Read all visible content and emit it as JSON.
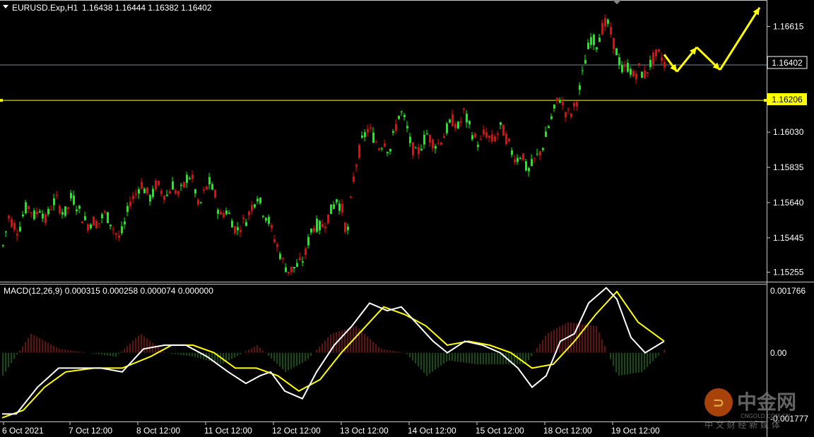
{
  "header": {
    "symbol_label": "EURUSD.Exp,H1",
    "ohlc": "1.16438 1.16444 1.16382 1.16402",
    "menu_icon": "triangle-down-icon"
  },
  "macd": {
    "label": "MACD(12,26,9) 0.000315 0.000258 0.000074 0.000000",
    "scale_top": "0.001766",
    "scale_zero": "0.00",
    "scale_bottom": "-0.001777"
  },
  "price_levels": {
    "current": "1.16402",
    "horizontal": "1.16206"
  },
  "watermark": {
    "brand": "中金网",
    "url": "CNGOLD.COM.CN",
    "tagline": "中 文 财 经 新 媒 体"
  },
  "colors": {
    "background": "#000000",
    "bull": "#00ff00",
    "bear": "#ff0000",
    "macd_line": "#ffffff",
    "signal_line": "#ffff00",
    "hist_pos": "#8b1a1a",
    "hist_neg": "#1f6b1f",
    "hline": "#ffff00",
    "bid_line": "#778899",
    "grid": "#c8c8c8"
  },
  "chart_data": [
    {
      "type": "candlestick",
      "series_name": "EURUSD.Exp,H1",
      "y_ticks": [
        "1.16615",
        "1.16030",
        "1.15835",
        "1.15640",
        "1.15445",
        "1.15255"
      ],
      "ylim": [
        1.1521,
        1.1675
      ],
      "x_ticks": [
        "6 Oct 2021",
        "7 Oct 12:00",
        "8 Oct 12:00",
        "11 Oct 12:00",
        "12 Oct 12:00",
        "13 Oct 12:00",
        "14 Oct 12:00",
        "15 Oct 12:00",
        "18 Oct 12:00",
        "19 Oct 12:00"
      ],
      "close_path": [
        [
          0,
          1.154
        ],
        [
          8,
          1.1556
        ],
        [
          15,
          1.1552
        ],
        [
          22,
          1.1548
        ],
        [
          30,
          1.156
        ],
        [
          37,
          1.1562
        ],
        [
          45,
          1.1556
        ],
        [
          53,
          1.1562
        ],
        [
          60,
          1.1554
        ],
        [
          68,
          1.1562
        ],
        [
          75,
          1.1566
        ],
        [
          82,
          1.156
        ],
        [
          90,
          1.1558
        ],
        [
          97,
          1.1568
        ],
        [
          105,
          1.1562
        ],
        [
          112,
          1.1556
        ],
        [
          120,
          1.1552
        ],
        [
          128,
          1.1554
        ],
        [
          135,
          1.1552
        ],
        [
          143,
          1.1558
        ],
        [
          150,
          1.1555
        ],
        [
          158,
          1.1548
        ],
        [
          165,
          1.1544
        ],
        [
          172,
          1.1552
        ],
        [
          180,
          1.1565
        ],
        [
          187,
          1.1568
        ],
        [
          195,
          1.1575
        ],
        [
          202,
          1.157
        ],
        [
          210,
          1.1566
        ],
        [
          217,
          1.1575
        ],
        [
          225,
          1.157
        ],
        [
          232,
          1.1568
        ],
        [
          240,
          1.1574
        ],
        [
          247,
          1.1568
        ],
        [
          255,
          1.1572
        ],
        [
          262,
          1.158
        ],
        [
          270,
          1.1575
        ],
        [
          277,
          1.156
        ],
        [
          285,
          1.157
        ],
        [
          292,
          1.1575
        ],
        [
          300,
          1.1568
        ],
        [
          307,
          1.1556
        ],
        [
          315,
          1.156
        ],
        [
          322,
          1.1556
        ],
        [
          330,
          1.1548
        ],
        [
          337,
          1.1552
        ],
        [
          345,
          1.1555
        ],
        [
          352,
          1.1562
        ],
        [
          360,
          1.1568
        ],
        [
          367,
          1.156
        ],
        [
          375,
          1.1555
        ],
        [
          382,
          1.1546
        ],
        [
          390,
          1.1538
        ],
        [
          397,
          1.153
        ],
        [
          405,
          1.1526
        ],
        [
          412,
          1.1528
        ],
        [
          420,
          1.153
        ],
        [
          427,
          1.1534
        ],
        [
          435,
          1.1548
        ],
        [
          442,
          1.1552
        ],
        [
          450,
          1.155
        ],
        [
          457,
          1.1554
        ],
        [
          465,
          1.156
        ],
        [
          472,
          1.1566
        ],
        [
          480,
          1.156
        ],
        [
          487,
          1.1545
        ],
        [
          495,
          1.1575
        ],
        [
          502,
          1.159
        ],
        [
          510,
          1.16
        ],
        [
          517,
          1.1605
        ],
        [
          525,
          1.16
        ],
        [
          532,
          1.1595
        ],
        [
          540,
          1.1598
        ],
        [
          547,
          1.1592
        ],
        [
          555,
          1.1605
        ],
        [
          562,
          1.1615
        ],
        [
          570,
          1.1608
        ],
        [
          577,
          1.1596
        ],
        [
          585,
          1.159
        ],
        [
          592,
          1.1596
        ],
        [
          600,
          1.1602
        ],
        [
          607,
          1.1598
        ],
        [
          615,
          1.1596
        ],
        [
          622,
          1.16
        ],
        [
          630,
          1.1606
        ],
        [
          637,
          1.161
        ],
        [
          645,
          1.1605
        ],
        [
          652,
          1.1614
        ],
        [
          660,
          1.1606
        ],
        [
          667,
          1.16
        ],
        [
          675,
          1.1596
        ],
        [
          682,
          1.1604
        ],
        [
          690,
          1.1598
        ],
        [
          697,
          1.16
        ],
        [
          705,
          1.1606
        ],
        [
          712,
          1.16
        ],
        [
          720,
          1.1592
        ],
        [
          727,
          1.1588
        ],
        [
          735,
          1.1592
        ],
        [
          742,
          1.158
        ],
        [
          750,
          1.1586
        ],
        [
          757,
          1.159
        ],
        [
          765,
          1.1596
        ],
        [
          772,
          1.1606
        ],
        [
          780,
          1.1615
        ],
        [
          787,
          1.1623
        ],
        [
          795,
          1.1615
        ],
        [
          802,
          1.1612
        ],
        [
          810,
          1.1618
        ],
        [
          817,
          1.1628
        ],
        [
          825,
          1.1645
        ],
        [
          832,
          1.1655
        ],
        [
          840,
          1.1652
        ],
        [
          847,
          1.166
        ],
        [
          855,
          1.1664
        ],
        [
          862,
          1.1655
        ],
        [
          870,
          1.1645
        ],
        [
          877,
          1.1636
        ],
        [
          885,
          1.164
        ],
        [
          892,
          1.1634
        ],
        [
          900,
          1.1638
        ],
        [
          907,
          1.1634
        ],
        [
          915,
          1.164
        ],
        [
          922,
          1.1645
        ],
        [
          930,
          1.1646
        ],
        [
          937,
          1.164
        ]
      ],
      "projection_arrows": [
        [
          [
            937,
            1.1646
          ],
          [
            955,
            1.16365
          ],
          [
            983,
            1.165
          ],
          [
            1016,
            1.16375
          ],
          [
            1072,
            1.1672
          ]
        ]
      ]
    },
    {
      "type": "macd",
      "ylim": [
        -0.001777,
        0.001766
      ],
      "macd_line": [
        [
          0,
          -0.0016
        ],
        [
          20,
          -0.0016
        ],
        [
          50,
          -0.0009
        ],
        [
          80,
          -0.0004
        ],
        [
          110,
          -0.0004
        ],
        [
          140,
          -0.0004
        ],
        [
          170,
          -0.0005
        ],
        [
          200,
          0.0001
        ],
        [
          230,
          0.0002
        ],
        [
          260,
          0.0002
        ],
        [
          290,
          -0.0001
        ],
        [
          320,
          -0.0005
        ],
        [
          345,
          -0.0008
        ],
        [
          365,
          -0.0006
        ],
        [
          380,
          -0.0005
        ],
        [
          400,
          -0.001
        ],
        [
          425,
          -0.0012
        ],
        [
          445,
          -0.0005
        ],
        [
          470,
          0.0002
        ],
        [
          495,
          0.0007
        ],
        [
          520,
          0.0013
        ],
        [
          545,
          0.0011
        ],
        [
          565,
          0.0012
        ],
        [
          585,
          0.0008
        ],
        [
          610,
          0.0003
        ],
        [
          630,
          0.0
        ],
        [
          655,
          0.0003
        ],
        [
          680,
          0.0002
        ],
        [
          705,
          0.0
        ],
        [
          730,
          -0.0004
        ],
        [
          750,
          -0.0009
        ],
        [
          770,
          -0.0006
        ],
        [
          790,
          0.0003
        ],
        [
          810,
          0.0005
        ],
        [
          830,
          0.0013
        ],
        [
          855,
          0.0017
        ],
        [
          870,
          0.0014
        ],
        [
          890,
          0.0004
        ],
        [
          910,
          0.0
        ],
        [
          937,
          0.0003
        ]
      ],
      "signal_line": [
        [
          0,
          -0.0017
        ],
        [
          30,
          -0.0015
        ],
        [
          60,
          -0.0009
        ],
        [
          90,
          -0.0005
        ],
        [
          130,
          -0.0004
        ],
        [
          170,
          -0.0004
        ],
        [
          210,
          -0.0001
        ],
        [
          240,
          0.0002
        ],
        [
          270,
          0.0002
        ],
        [
          300,
          0.0
        ],
        [
          330,
          -0.0004
        ],
        [
          360,
          -0.0004
        ],
        [
          390,
          -0.0006
        ],
        [
          420,
          -0.001
        ],
        [
          450,
          -0.0007
        ],
        [
          480,
          0.0
        ],
        [
          510,
          0.0006
        ],
        [
          540,
          0.0012
        ],
        [
          570,
          0.001
        ],
        [
          600,
          0.0007
        ],
        [
          630,
          0.0002
        ],
        [
          660,
          0.0003
        ],
        [
          690,
          0.0002
        ],
        [
          720,
          0.0
        ],
        [
          750,
          -0.0004
        ],
        [
          780,
          -0.0003
        ],
        [
          810,
          0.0003
        ],
        [
          840,
          0.001
        ],
        [
          870,
          0.0016
        ],
        [
          900,
          0.0008
        ],
        [
          937,
          0.0003
        ]
      ],
      "histogram": [
        [
          0,
          -0.0006
        ],
        [
          40,
          0.0005
        ],
        [
          80,
          0.0001
        ],
        [
          120,
          0.0
        ],
        [
          160,
          -0.0001
        ],
        [
          195,
          0.0005
        ],
        [
          230,
          0.0
        ],
        [
          270,
          -0.0001
        ],
        [
          310,
          -0.0003
        ],
        [
          360,
          0.0002
        ],
        [
          400,
          -0.0005
        ],
        [
          430,
          -0.0002
        ],
        [
          465,
          0.0005
        ],
        [
          500,
          0.0007
        ],
        [
          535,
          0.0001
        ],
        [
          570,
          0.0
        ],
        [
          600,
          -0.0006
        ],
        [
          630,
          -0.0002
        ],
        [
          670,
          -0.0003
        ],
        [
          710,
          -0.0003
        ],
        [
          740,
          -0.0003
        ],
        [
          770,
          0.0005
        ],
        [
          800,
          0.0008
        ],
        [
          840,
          0.0007
        ],
        [
          870,
          -0.0006
        ],
        [
          905,
          -0.0005
        ],
        [
          937,
          0.0001
        ]
      ]
    }
  ]
}
